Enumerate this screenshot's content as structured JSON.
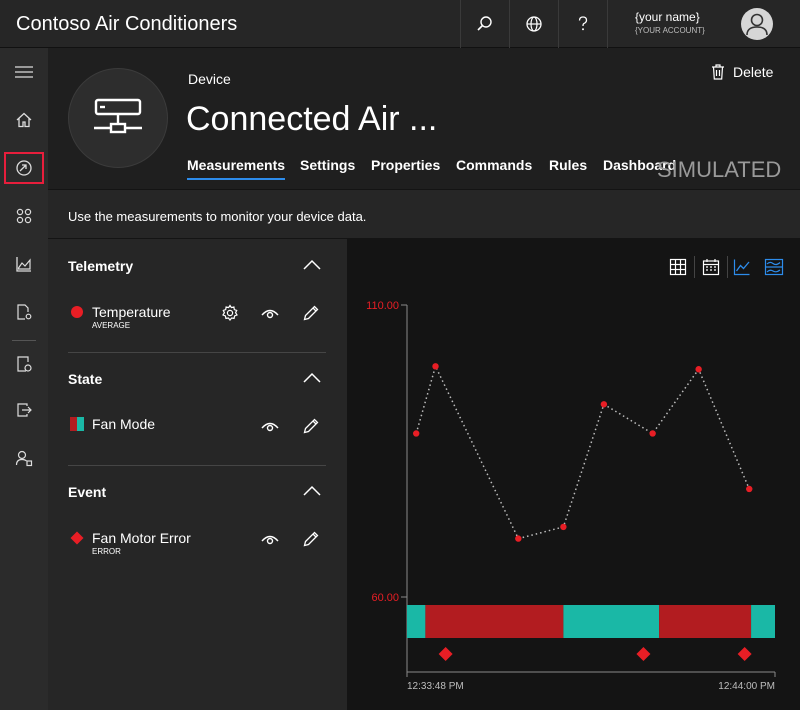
{
  "app": {
    "title": "Contoso Air Conditioners"
  },
  "user": {
    "name": "{your name}",
    "account": "{YOUR ACCOUNT}"
  },
  "header": {
    "device_label": "Device",
    "device_name": "Connected Air ...",
    "delete_label": "Delete",
    "simulated": "SIMULATED",
    "tabs": [
      {
        "label": "Measurements",
        "active": true
      },
      {
        "label": "Settings"
      },
      {
        "label": "Properties"
      },
      {
        "label": "Commands"
      },
      {
        "label": "Rules"
      },
      {
        "label": "Dashboard"
      }
    ]
  },
  "info": {
    "text": "Use the measurements to monitor your device data."
  },
  "sections": [
    {
      "title": "Telemetry",
      "items": [
        {
          "name": "Temperature",
          "sub": "AVERAGE",
          "color": "#e81e25",
          "marker": "circle"
        }
      ]
    },
    {
      "title": "State",
      "items": [
        {
          "name": "Fan Mode",
          "color": "#e81e25",
          "color2": "#1ab8a6",
          "marker": "split"
        }
      ]
    },
    {
      "title": "Event",
      "items": [
        {
          "name": "Fan Motor Error",
          "sub": "ERROR",
          "color": "#e81e25",
          "marker": "diamond"
        }
      ]
    }
  ],
  "sidebar": {
    "icons": [
      "hamburger-icon",
      "home-icon",
      "device-explorer-icon",
      "apps-grid-icon",
      "analytics-icon",
      "jobs-icon",
      "device-templates-icon",
      "data-export-icon",
      "administration-icon"
    ],
    "active": "device-explorer-icon"
  },
  "colors": {
    "accent": "#2d8ceb",
    "red": "#e81e25",
    "state_red": "#b21c20",
    "state_teal": "#1ab8a6"
  },
  "chart_data": {
    "type": "line",
    "ylim": [
      60,
      110
    ],
    "y_tick_labels": [
      "110.00",
      "60.00"
    ],
    "x_tick_labels": [
      "12:33:48 PM",
      "12:44:00 PM"
    ],
    "series": [
      {
        "name": "Temperature",
        "style": "dotted",
        "x": [
          0.1,
          0.31,
          1.21,
          1.7,
          2.14,
          2.67,
          3.17,
          3.72
        ],
        "y": [
          88,
          99.5,
          70,
          72,
          93,
          88,
          99,
          78.5
        ]
      }
    ],
    "x_domain": [
      0,
      4
    ],
    "state_bands": [
      {
        "from": 0,
        "to": 0.2,
        "state": "teal"
      },
      {
        "from": 0.2,
        "to": 1.7,
        "state": "red"
      },
      {
        "from": 1.7,
        "to": 2.74,
        "state": "teal"
      },
      {
        "from": 2.74,
        "to": 3.74,
        "state": "red"
      },
      {
        "from": 3.74,
        "to": 4.0,
        "state": "teal"
      }
    ],
    "events": [
      0.42,
      2.57,
      3.67
    ]
  }
}
